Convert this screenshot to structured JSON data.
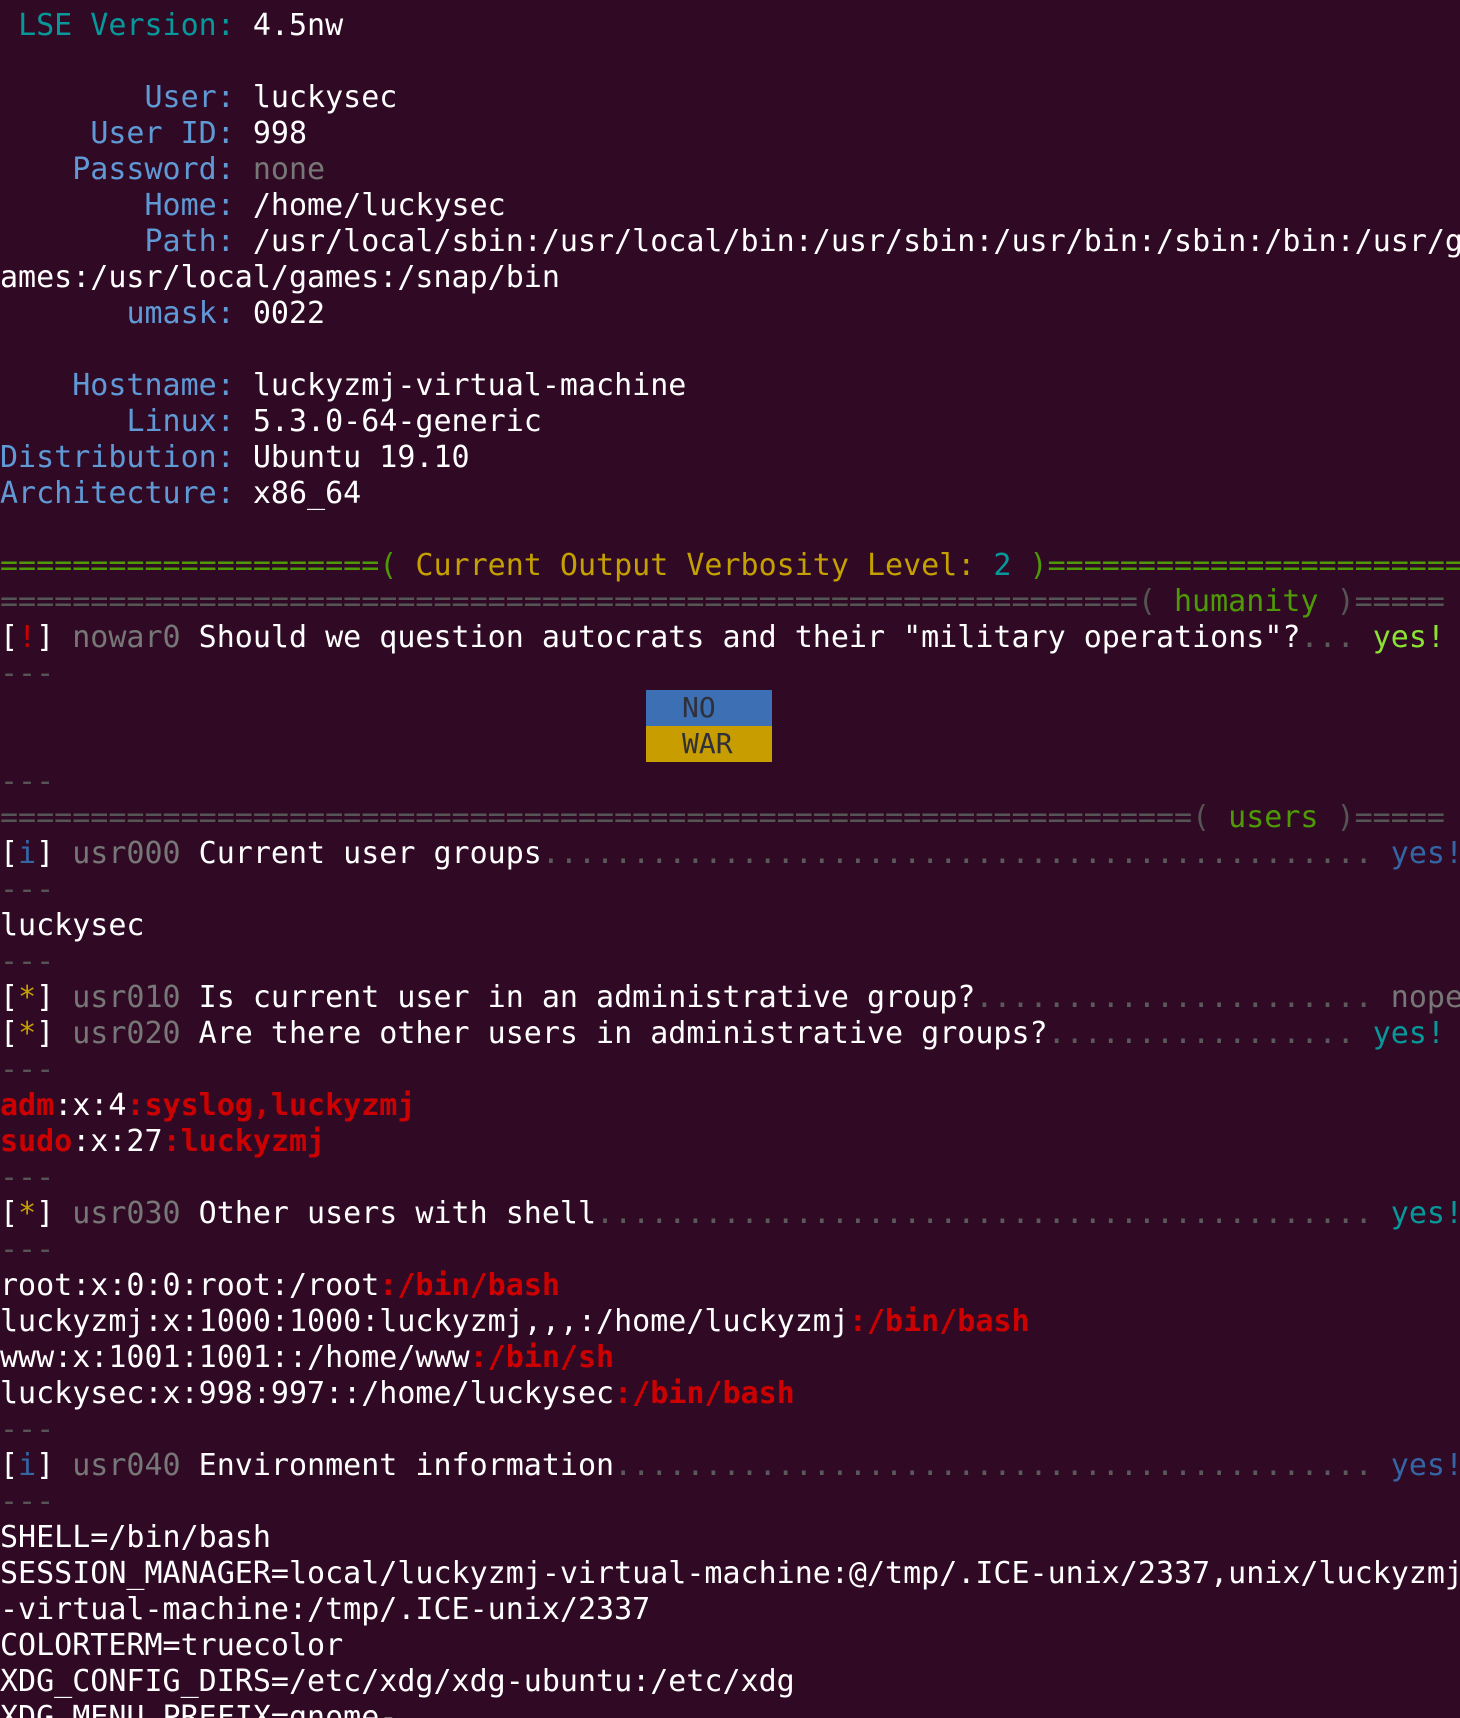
{
  "lse": {
    "label": "LSE Version:",
    "value": "4.5nw"
  },
  "info": {
    "user_label": "User:",
    "user": "luckysec",
    "uid_label": "User ID:",
    "uid": "998",
    "password_label": "Password:",
    "password": "none",
    "home_label": "Home:",
    "home": "/home/luckysec",
    "path_label": "Path:",
    "path_1": "/usr/local/sbin:/usr/local/bin:/usr/sbin:/usr/bin:/sbin:/bin:/usr/g",
    "path_2": "ames:/usr/local/games:/snap/bin",
    "umask_label": "umask:",
    "umask": "0022",
    "hostname_label": "Hostname:",
    "hostname": "luckyzmj-virtual-machine",
    "linux_label": "Linux:",
    "linux": "5.3.0-64-generic",
    "distro_label": "Distribution:",
    "distro": "Ubuntu 19.10",
    "arch_label": "Architecture:",
    "arch": "x86_64"
  },
  "verbosity": {
    "left": "=====================(",
    "text": " Current Output Verbosity Level: ",
    "level": "2",
    "right": " )======================="
  },
  "sections": {
    "humanity": {
      "pre": "===============================================================(",
      "name": " humanity ",
      "post": ")====="
    },
    "users": {
      "pre": "==================================================================(",
      "name": " users ",
      "post": ")====="
    }
  },
  "separator": "---",
  "checks": {
    "nowar0": {
      "mark": "!",
      "id": "nowar0",
      "text": " Should we question autocrats and their \"military operations\"?",
      "dots": "...",
      "result": "yes!"
    },
    "usr000": {
      "mark": "i",
      "id": "usr000",
      "text": " Current user groups",
      "dots": "..............................................",
      "result": "yes!"
    },
    "usr010": {
      "mark": "*",
      "id": "usr010",
      "text": " Is current user in an administrative group?",
      "dots": "......................",
      "result": "nope"
    },
    "usr020": {
      "mark": "*",
      "id": "usr020",
      "text": " Are there other users in administrative groups?",
      "dots": ".................",
      "result": "yes!"
    },
    "usr030": {
      "mark": "*",
      "id": "usr030",
      "text": " Other users with shell",
      "dots": "...........................................",
      "result": "yes!"
    },
    "usr040": {
      "mark": "i",
      "id": "usr040",
      "text": " Environment information",
      "dots": "..........................................",
      "result": "yes!"
    }
  },
  "flag": {
    "top": "NO",
    "bottom": "WAR"
  },
  "groups_output": "luckysec",
  "admin_groups": [
    {
      "name": "adm",
      "mid": ":x:4",
      "members": ":syslog,luckyzmj"
    },
    {
      "name": "sudo",
      "mid": ":x:27",
      "members": ":luckyzmj"
    }
  ],
  "shell_users": [
    {
      "entry": "root:x:0:0:root:/root",
      "shell": ":/bin/bash"
    },
    {
      "entry": "luckyzmj:x:1000:1000:luckyzmj,,,:/home/luckyzmj",
      "shell": ":/bin/bash"
    },
    {
      "entry": "www:x:1001:1001::/home/www",
      "shell": ":/bin/sh"
    },
    {
      "entry": "luckysec:x:998:997::/home/luckysec",
      "shell": ":/bin/bash"
    }
  ],
  "env": [
    "SHELL=/bin/bash",
    "SESSION_MANAGER=local/luckyzmj-virtual-machine:@/tmp/.ICE-unix/2337,unix/luckyzmj",
    "-virtual-machine:/tmp/.ICE-unix/2337",
    "COLORTERM=truecolor",
    "XDG_CONFIG_DIRS=/etc/xdg/xdg-ubuntu:/etc/xdg",
    "XDG_MENU_PREFIX=gnome-"
  ]
}
